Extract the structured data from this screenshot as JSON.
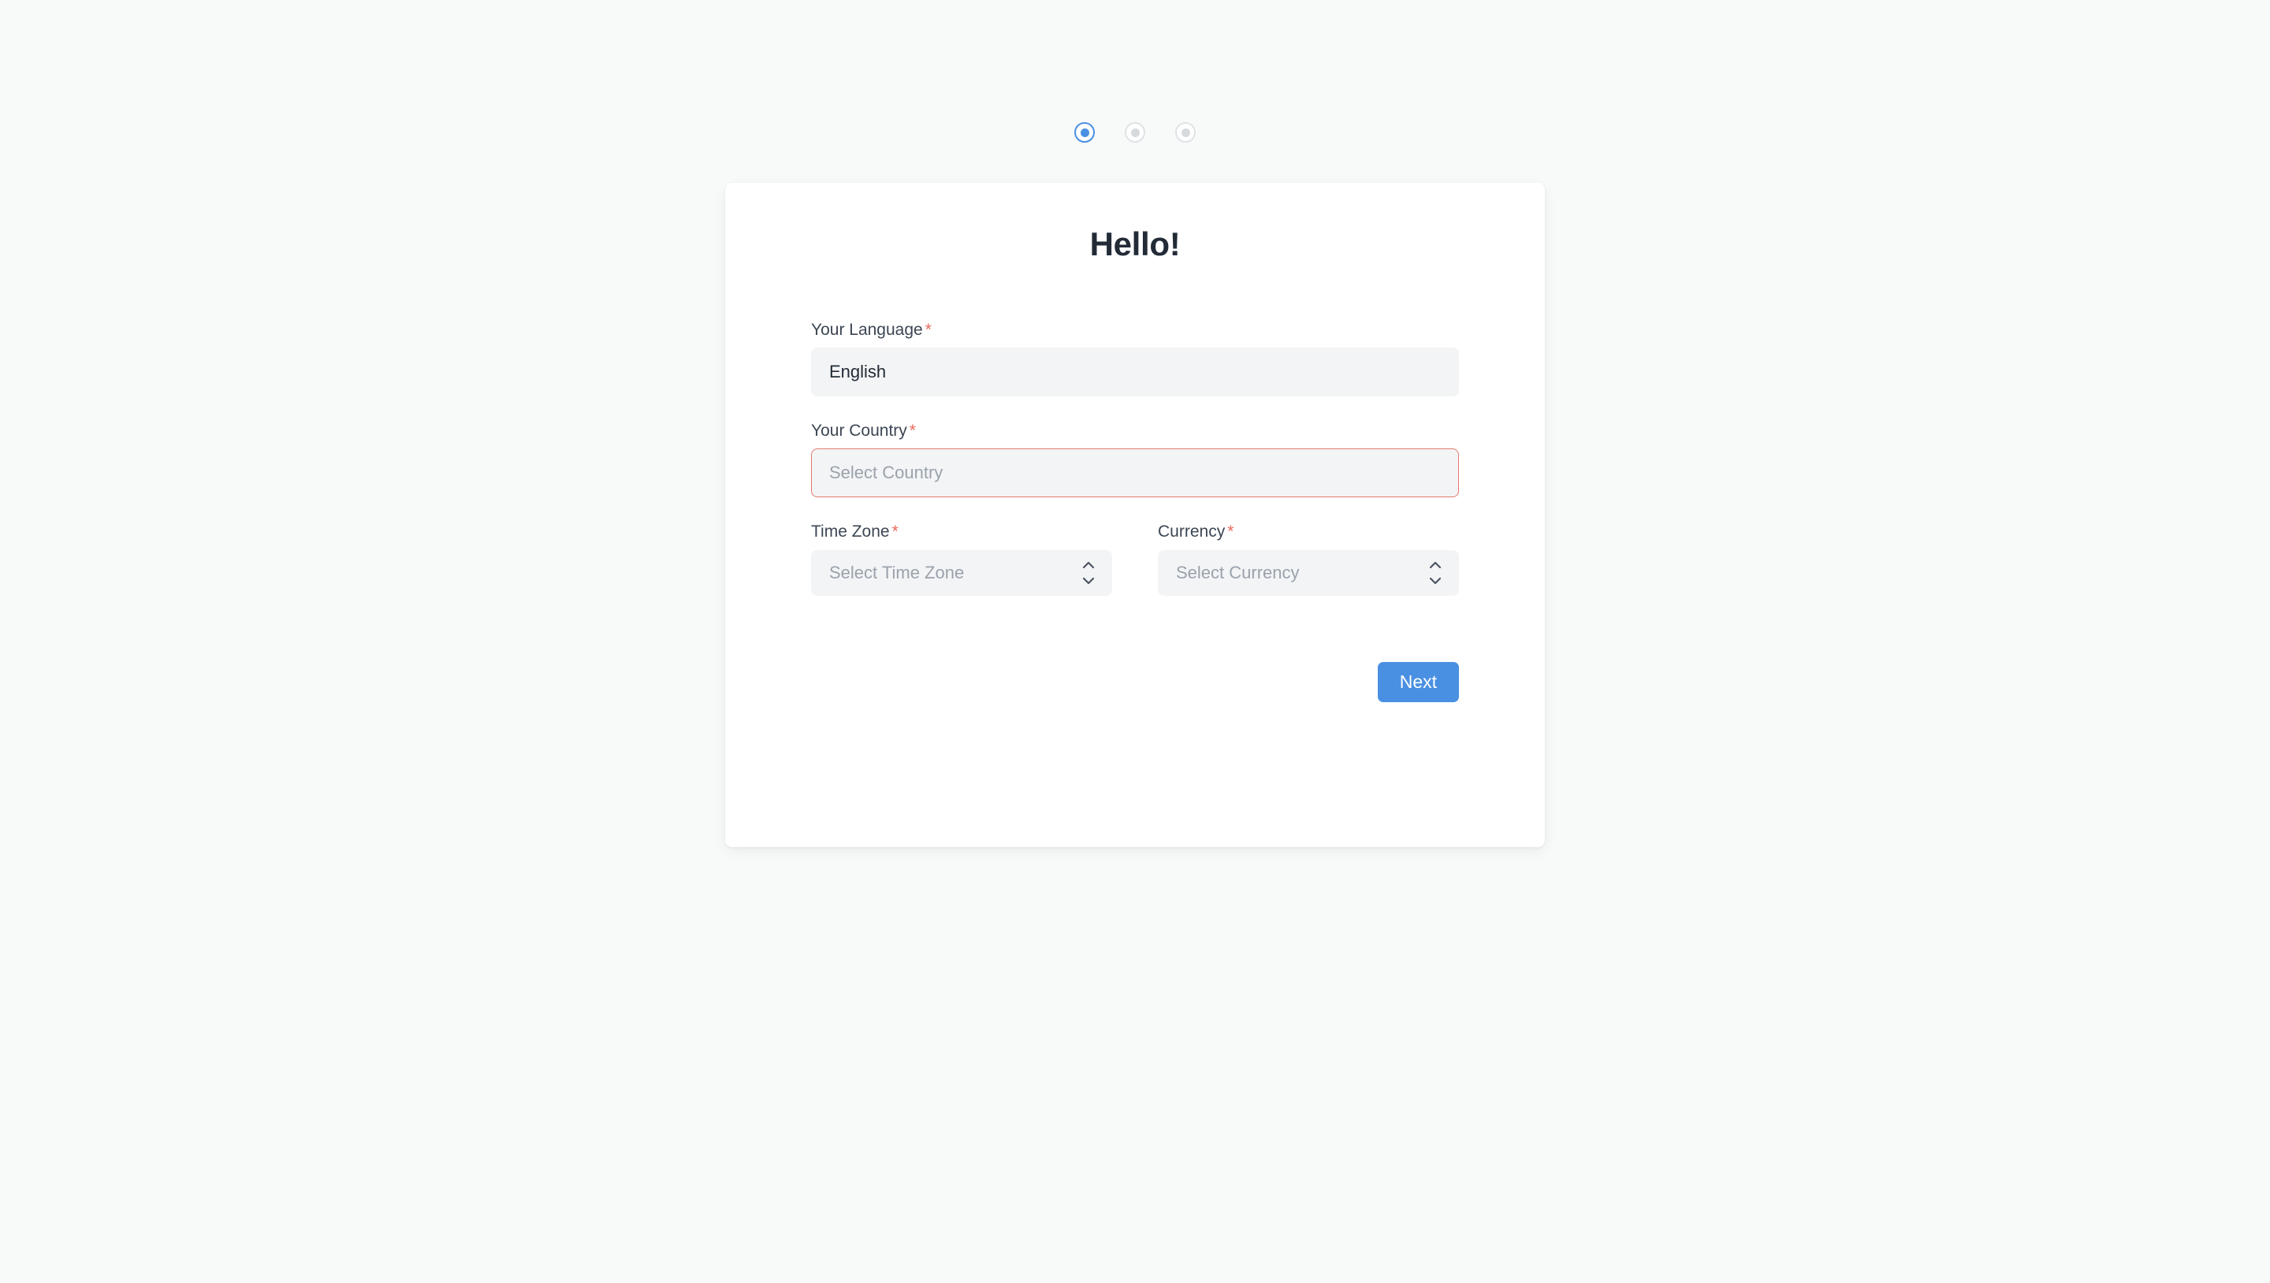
{
  "wizard": {
    "steps": [
      {
        "name": "step-1",
        "state": "active"
      },
      {
        "name": "step-2",
        "state": "inactive"
      },
      {
        "name": "step-3",
        "state": "inactive"
      }
    ],
    "active_index": 0
  },
  "card": {
    "title": "Hello!"
  },
  "form": {
    "required_marker": "*",
    "fields": {
      "language": {
        "label": "Your Language",
        "value": "English",
        "placeholder": "",
        "required": true,
        "state": "filled"
      },
      "country": {
        "label": "Your Country",
        "value": "",
        "placeholder": "Select Country",
        "required": true,
        "state": "error"
      },
      "time_zone": {
        "label": "Time Zone",
        "value": "",
        "placeholder": "Select Time Zone",
        "required": true,
        "state": "empty"
      },
      "currency": {
        "label": "Currency",
        "value": "",
        "placeholder": "Select Currency",
        "required": true,
        "state": "empty"
      }
    }
  },
  "actions": {
    "next_label": "Next"
  },
  "colors": {
    "page_background": "#f8f9f9",
    "card_background": "#ffffff",
    "accent_blue": "#4a90e2",
    "required_red": "#e8695a",
    "error_border": "#e5796c",
    "input_background": "#f3f4f6",
    "placeholder_text": "#9aa2ab",
    "title_text": "#222b36",
    "label_text": "#3c4653",
    "step_inactive": "#dfe3e6"
  },
  "icons": {
    "stepper": "chevron-up-down-icon"
  }
}
